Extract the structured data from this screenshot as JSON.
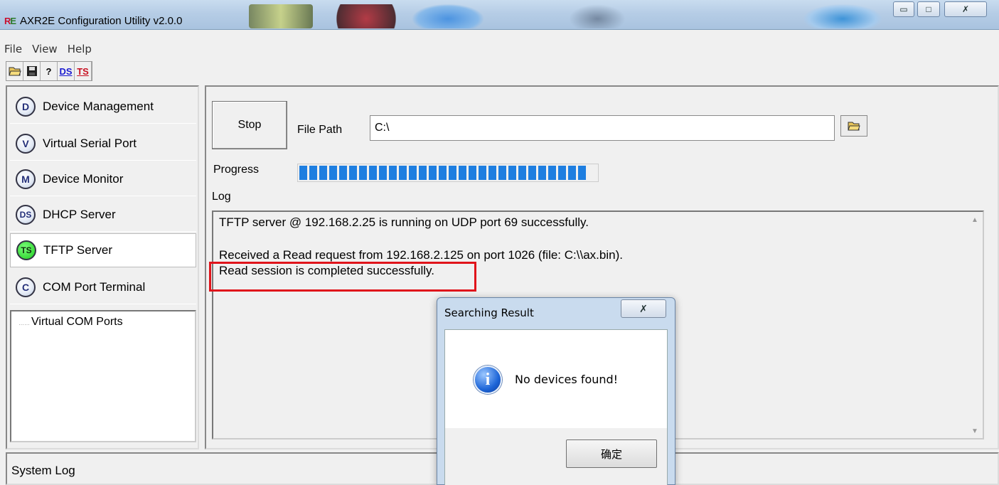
{
  "window": {
    "title": "AXR2E Configuration Utility v2.0.0",
    "controls": [
      "minimize",
      "maximize",
      "close"
    ]
  },
  "menu": [
    "File",
    "View",
    "Help"
  ],
  "toolbar": {
    "buttons": [
      {
        "name": "open-folder-icon"
      },
      {
        "name": "save-icon"
      },
      {
        "name": "help-icon"
      },
      {
        "label": "DS"
      },
      {
        "label": "TS"
      }
    ]
  },
  "sidebar": {
    "items": [
      {
        "icon": "D",
        "label": "Device Management"
      },
      {
        "icon": "V",
        "label": "Virtual Serial Port"
      },
      {
        "icon": "M",
        "label": "Device Monitor"
      },
      {
        "icon": "DS",
        "label": "DHCP Server"
      },
      {
        "icon": "TS",
        "label": "TFTP Server",
        "active": true
      },
      {
        "icon": "C",
        "label": "COM Port Terminal"
      }
    ],
    "tree": {
      "root": "Virtual COM Ports"
    }
  },
  "main": {
    "stop_label": "Stop",
    "file_path_label": "File Path",
    "file_path_value": "C:\\",
    "progress_label": "Progress",
    "progress_fraction": 1.0,
    "log_label": "Log",
    "log_lines": [
      "TFTP server @ 192.168.2.25 is running on UDP port 69 successfully.",
      "",
      "Received a Read request from 192.168.2.125 on port 1026 (file: C:\\\\ax.bin).",
      "Read session is completed successfully."
    ]
  },
  "system_log_label": "System Log",
  "dialog": {
    "title": "Searching Result",
    "message": "No devices found!",
    "ok_label": "确定"
  },
  "colors": {
    "progress": "#1e7ee0",
    "highlight": "#e0141b",
    "active_icon": "#1ecb1e"
  }
}
